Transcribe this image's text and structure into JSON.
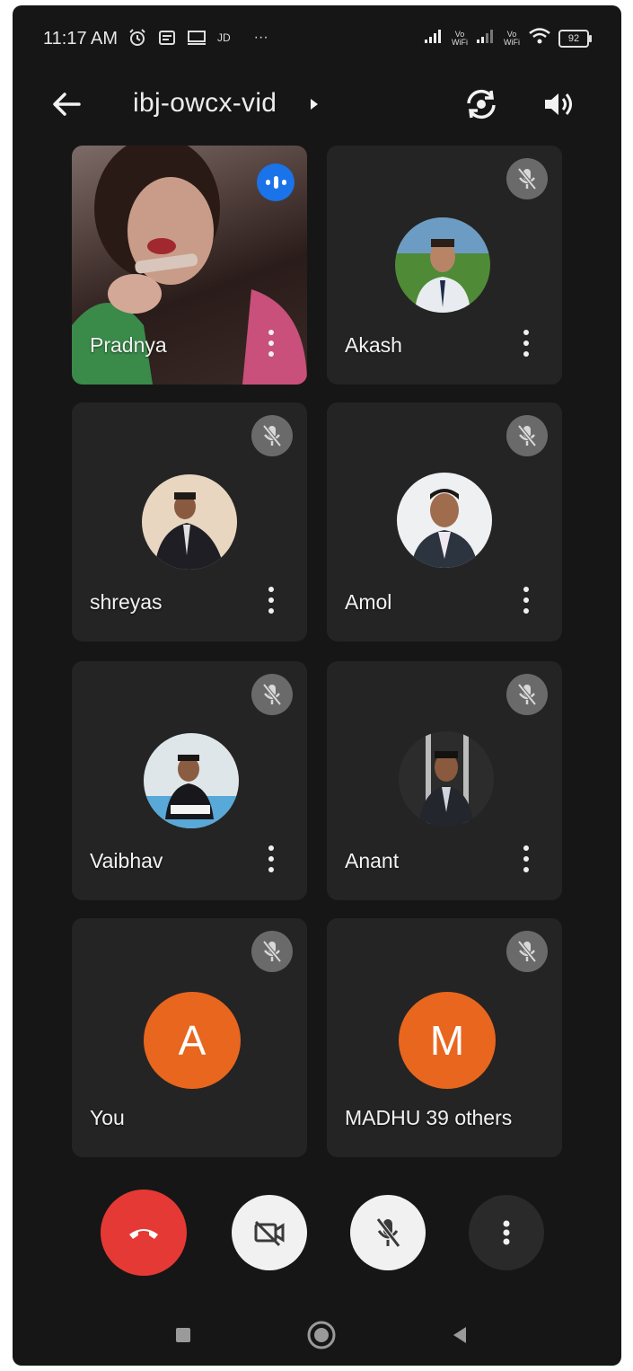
{
  "status_bar": {
    "time": "11:17 AM",
    "left_icons": [
      "alarm-icon",
      "notification-icon",
      "screen-icon",
      "jd-icon",
      "more-notifications-icon"
    ],
    "jd_label": "JD",
    "more_label": "···",
    "sim1_label": "Vo WiFi",
    "sim2_label": "Vo WiFi",
    "battery": "92"
  },
  "header": {
    "title": "ibj-owcx-vid",
    "icons": [
      "back-arrow-icon",
      "switch-camera-icon",
      "speaker-icon"
    ]
  },
  "tiles": [
    {
      "name": "Pradnya",
      "state": "speaking-video"
    },
    {
      "name": "Akash",
      "state": "muted"
    },
    {
      "name": "shreyas",
      "state": "muted"
    },
    {
      "name": "Amol",
      "state": "muted"
    },
    {
      "name": "Vaibhav",
      "state": "muted"
    },
    {
      "name": "Anant",
      "state": "muted"
    },
    {
      "name": "You",
      "state": "muted",
      "initial": "A"
    },
    {
      "name": "MADHU",
      "state": "muted",
      "initial": "M",
      "others_label": "39 others"
    }
  ],
  "controls": {
    "buttons": [
      "end-call-icon",
      "camera-off-icon",
      "mic-off-icon",
      "more-vert-icon"
    ],
    "colors": {
      "end_call": "#e53935",
      "control_light": "#f1f1f1",
      "control_dark": "#2a2a2a"
    }
  },
  "nav": [
    "recent-apps-icon",
    "home-icon",
    "back-nav-icon"
  ],
  "colors": {
    "background": "#161616",
    "tile": "#242424",
    "speaking_badge": "#1a73e8",
    "avatar_orange": "#e8661e",
    "mute_badge": "#6a6a6a"
  }
}
